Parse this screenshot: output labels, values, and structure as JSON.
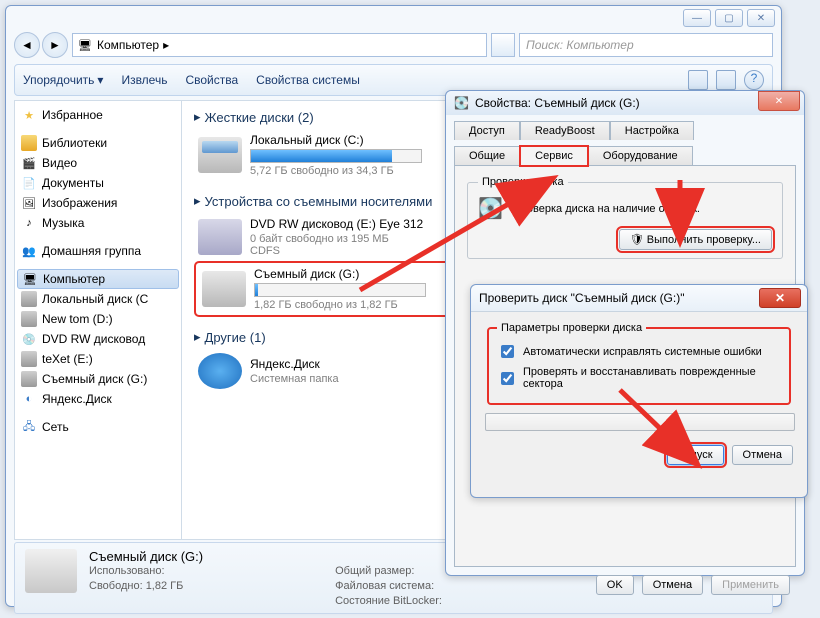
{
  "explorer": {
    "breadcrumb": "Компьютер",
    "search_placeholder": "Поиск: Компьютер",
    "toolbar": [
      "Упорядочить",
      "Извлечь",
      "Свойства",
      "Свойства системы"
    ],
    "sidebar": {
      "favorites": "Избранное",
      "libraries": "Библиотеки",
      "lib_items": [
        "Видео",
        "Документы",
        "Изображения",
        "Музыка"
      ],
      "homegroup": "Домашняя группа",
      "computer": "Компьютер",
      "drives": [
        "Локальный диск (C",
        "New tom (D:)",
        "DVD RW дисковод",
        "teXet (E:)",
        "Съемный диск (G:)",
        "Яндекс.Диск"
      ],
      "network": "Сеть"
    },
    "sections": {
      "hdd": {
        "title": "Жесткие диски (2)",
        "items": [
          {
            "name": "Локальный диск (C:)",
            "size": "5,72 ГБ свободно из 34,3 ГБ",
            "fill": 83
          }
        ]
      },
      "removable": {
        "title": "Устройства со съемными носителями",
        "items": [
          {
            "name": "DVD RW дисковод (E:) Eye 312",
            "size": "0 байт свободно из 195 МБ",
            "sub": "CDFS"
          },
          {
            "name": "Съемный диск (G:)",
            "size": "1,82 ГБ свободно из 1,82 ГБ",
            "fill": 2
          }
        ]
      },
      "other": {
        "title": "Другие (1)",
        "items": [
          {
            "name": "Яндекс.Диск",
            "size": "Системная папка"
          }
        ]
      }
    },
    "details": {
      "name": "Съемный диск (G:)",
      "labels": {
        "used": "Использовано:",
        "free": "Свободно:",
        "total": "Общий размер:",
        "fs": "Файловая система:",
        "bitlocker": "Состояние BitLocker:"
      },
      "free": "1,82 ГБ"
    }
  },
  "props": {
    "title": "Свойства: Съемный диск (G:)",
    "tabs_top": [
      "Доступ",
      "ReadyBoost",
      "Настройка"
    ],
    "tabs_bot": [
      "Общие",
      "Сервис",
      "Оборудование"
    ],
    "check_group": "Проверка диска",
    "check_text": "Проверка диска на наличие ошибок.",
    "check_btn": "Выполнить проверку...",
    "ok": "OK",
    "cancel": "Отмена",
    "apply": "Применить"
  },
  "check": {
    "title": "Проверить диск \"Съемный диск (G:)\"",
    "group": "Параметры проверки диска",
    "opt1": "Автоматически исправлять системные ошибки",
    "opt2": "Проверять и восстанавливать поврежденные сектора",
    "start": "Запуск",
    "cancel": "Отмена"
  }
}
